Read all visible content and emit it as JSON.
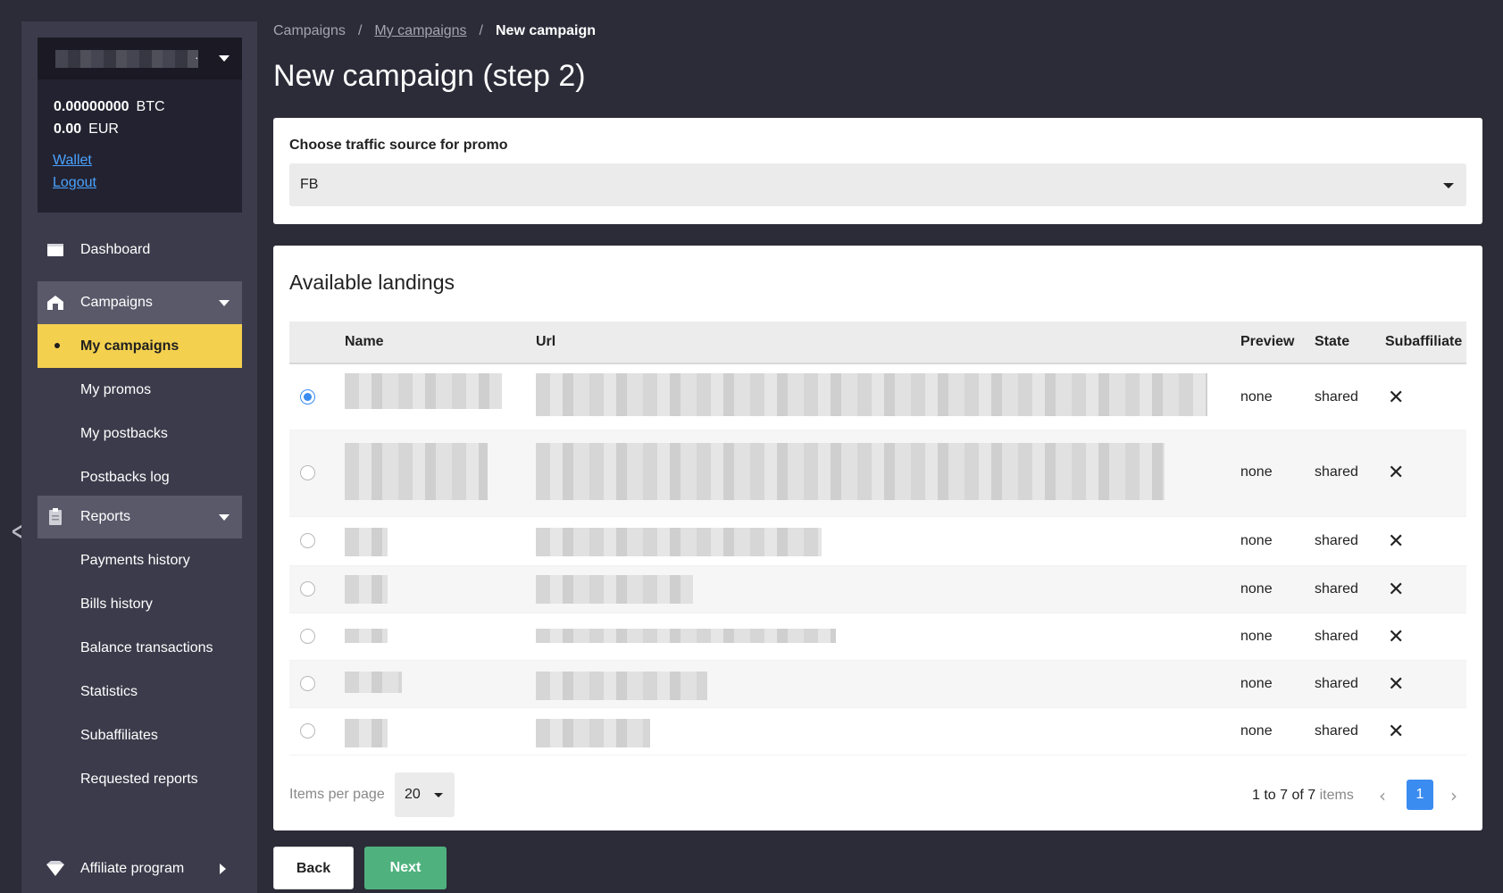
{
  "account": {
    "balance_btc": "0.00000000",
    "currency_btc": "BTC",
    "balance_eur": "0.00",
    "currency_eur": "EUR",
    "wallet_link": "Wallet",
    "logout_link": "Logout"
  },
  "sidebar": {
    "dashboard": "Dashboard",
    "campaigns": "Campaigns",
    "campaigns_items": [
      "My campaigns",
      "My promos",
      "My postbacks",
      "Postbacks log"
    ],
    "reports": "Reports",
    "reports_items": [
      "Payments history",
      "Bills history",
      "Balance transactions",
      "Statistics",
      "Subaffiliates",
      "Requested reports"
    ],
    "affiliate": "Affiliate program"
  },
  "breadcrumb": {
    "root": "Campaigns",
    "parent": "My campaigns",
    "current": "New campaign",
    "separator": "/"
  },
  "page_title": "New campaign (step 2)",
  "traffic": {
    "label": "Choose traffic source for promo",
    "value": "FB"
  },
  "landings": {
    "title": "Available landings",
    "columns": {
      "name": "Name",
      "url": "Url",
      "preview": "Preview",
      "state": "State",
      "subaffiliate": "Subaffiliate"
    },
    "rows": [
      {
        "preview": "none",
        "state": "shared",
        "subaffiliate": "✕",
        "selected": true
      },
      {
        "preview": "none",
        "state": "shared",
        "subaffiliate": "✕",
        "selected": false
      },
      {
        "preview": "none",
        "state": "shared",
        "subaffiliate": "✕",
        "selected": false
      },
      {
        "preview": "none",
        "state": "shared",
        "subaffiliate": "✕",
        "selected": false
      },
      {
        "preview": "none",
        "state": "shared",
        "subaffiliate": "✕",
        "selected": false
      },
      {
        "preview": "none",
        "state": "shared",
        "subaffiliate": "✕",
        "selected": false
      },
      {
        "preview": "none",
        "state": "shared",
        "subaffiliate": "✕",
        "selected": false
      }
    ]
  },
  "pagination": {
    "items_per_page_label": "Items per page",
    "items_per_page": "20",
    "range": "1 to 7 of 7",
    "range_suffix": "items",
    "current_page": "1",
    "prev": "‹",
    "next": "›"
  },
  "buttons": {
    "back": "Back",
    "next": "Next"
  },
  "colors": {
    "background": "#2c2b38",
    "sidebar": "#3c3b4b",
    "active_item": "#f4d04f",
    "primary": "#3b8cf0",
    "next_button": "#4fb27e"
  }
}
